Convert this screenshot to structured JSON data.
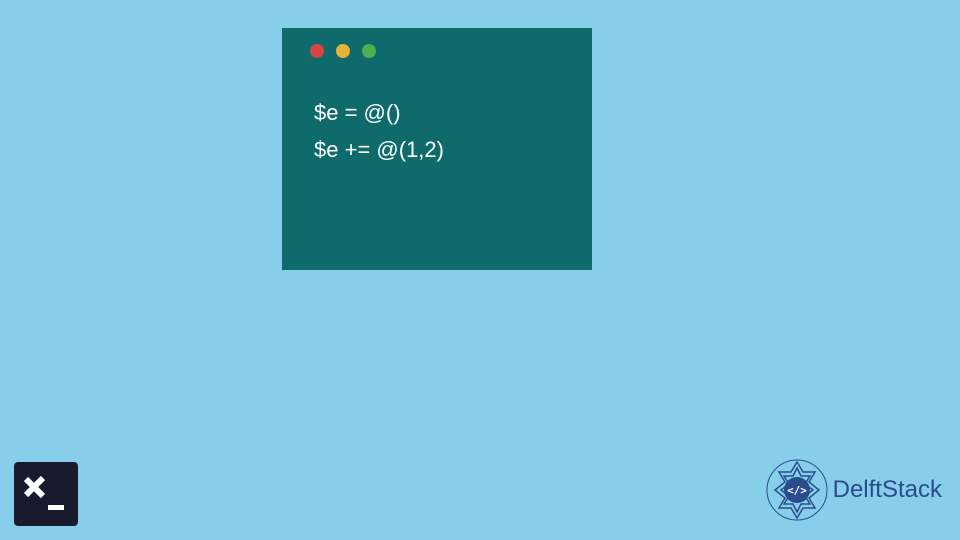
{
  "code": {
    "line1": "$e = @()",
    "line2": "$e += @(1,2)"
  },
  "branding": {
    "name": "DelftStack"
  },
  "colors": {
    "background": "#87CEEB",
    "window": "#0F6B6B",
    "brand": "#2B4C8C"
  }
}
